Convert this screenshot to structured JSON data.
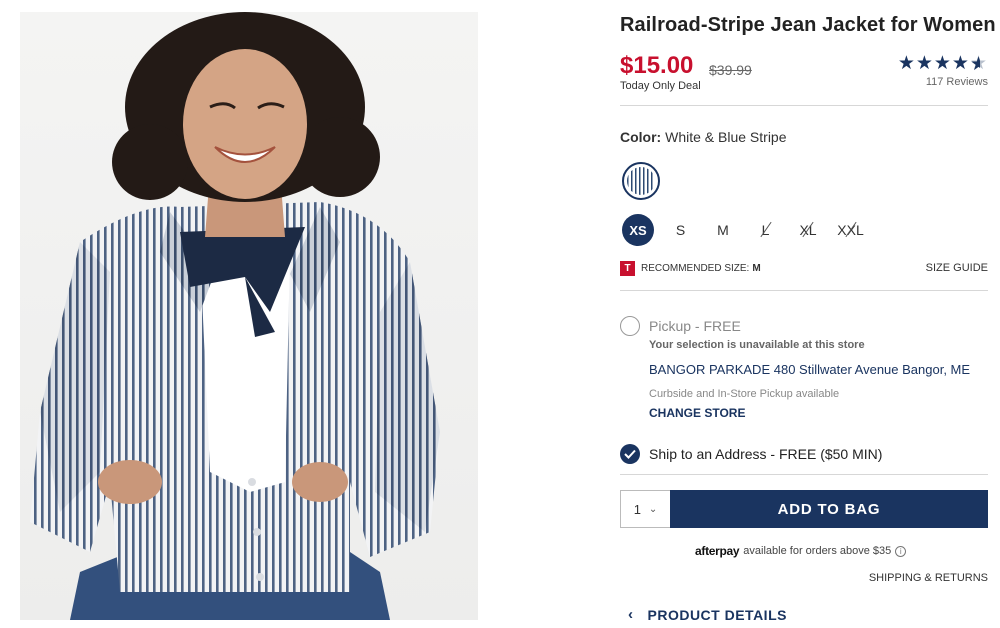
{
  "product": {
    "title": "Railroad-Stripe Jean Jacket for Women",
    "price": "$15.00",
    "original_price": "$39.99",
    "deal_text": "Today Only Deal",
    "rating": 4.5,
    "stars_glyph": "★★★★",
    "half_star_glyph": "★",
    "reviews": "117 Reviews"
  },
  "color": {
    "label": "Color:",
    "value": "White & Blue Stripe",
    "swatch_color": "#2d4a72"
  },
  "sizes": [
    {
      "label": "XS",
      "selected": true,
      "available": true
    },
    {
      "label": "S",
      "selected": false,
      "available": true
    },
    {
      "label": "M",
      "selected": false,
      "available": true
    },
    {
      "label": "L",
      "selected": false,
      "available": false
    },
    {
      "label": "XL",
      "selected": false,
      "available": false
    },
    {
      "label": "XXL",
      "selected": false,
      "available": false
    }
  ],
  "recommended": {
    "icon": "T",
    "label": "RECOMMENDED SIZE:",
    "value": "M",
    "size_guide": "SIZE GUIDE"
  },
  "pickup": {
    "label": "Pickup - FREE",
    "note": "Your selection is unavailable at this store",
    "store": "BANGOR PARKADE 480 Stillwater Avenue  Bangor, ME",
    "curbside": "Curbside and In-Store Pickup available",
    "change_store": "CHANGE STORE"
  },
  "ship": {
    "label": "Ship to an Address - FREE ($50 MIN)"
  },
  "cart": {
    "quantity": "1",
    "add_to_bag": "ADD TO BAG"
  },
  "afterpay": {
    "logo": "afterpay",
    "text": "available for orders above $35",
    "info": "i"
  },
  "links": {
    "shipping_returns": "SHIPPING & RETURNS",
    "product_details": "PRODUCT DETAILS"
  },
  "colors": {
    "brand_navy": "#1a3460",
    "sale_red": "#c8102e"
  }
}
